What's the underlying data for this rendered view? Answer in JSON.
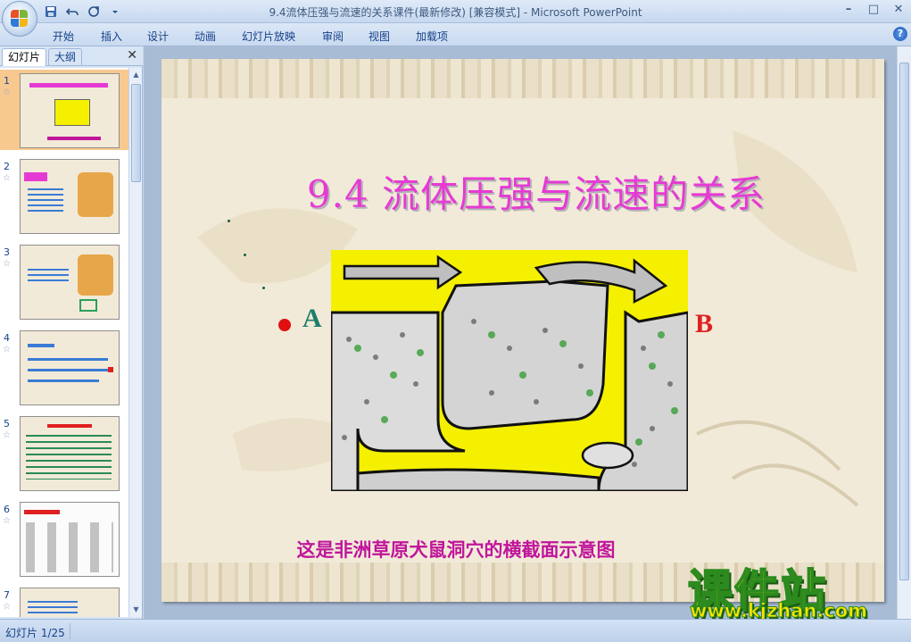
{
  "app": {
    "title": "9.4流体压强与流速的关系课件(最新修改) [兼容模式] - Microsoft PowerPoint"
  },
  "quick_access": {
    "save_icon": "save-icon",
    "undo_icon": "undo-icon",
    "redo_icon": "redo-icon",
    "customize_icon": "customize-icon"
  },
  "window_controls": [
    "minimize-icon",
    "restore-icon",
    "close-icon"
  ],
  "ribbon": {
    "tabs": [
      "开始",
      "插入",
      "设计",
      "动画",
      "幻灯片放映",
      "审阅",
      "视图",
      "加载项"
    ]
  },
  "left_pane": {
    "tabs": [
      "幻灯片",
      "大纲"
    ],
    "close_label": "✕",
    "thumbnails": [
      {
        "number": "1"
      },
      {
        "number": "2"
      },
      {
        "number": "3"
      },
      {
        "number": "4"
      },
      {
        "number": "5"
      },
      {
        "number": "6"
      },
      {
        "number": "7"
      }
    ]
  },
  "slide": {
    "title": "9.4 流体压强与流速的关系",
    "label_a": "A",
    "label_b": "B",
    "caption": "这是非洲草原犬鼠洞穴的横截面示意图"
  },
  "watermark": {
    "text": "课件站",
    "url": "www.kjzhan.com"
  },
  "status": {
    "slide_indicator": "幻灯片 1/25"
  },
  "colors": {
    "title": "#e63ad4",
    "caption": "#c0169b",
    "label_a": "#1e7e6a",
    "label_b": "#e02020",
    "diagram_background": "#f5f000",
    "selected_thumbnail": "#f7c98f"
  }
}
